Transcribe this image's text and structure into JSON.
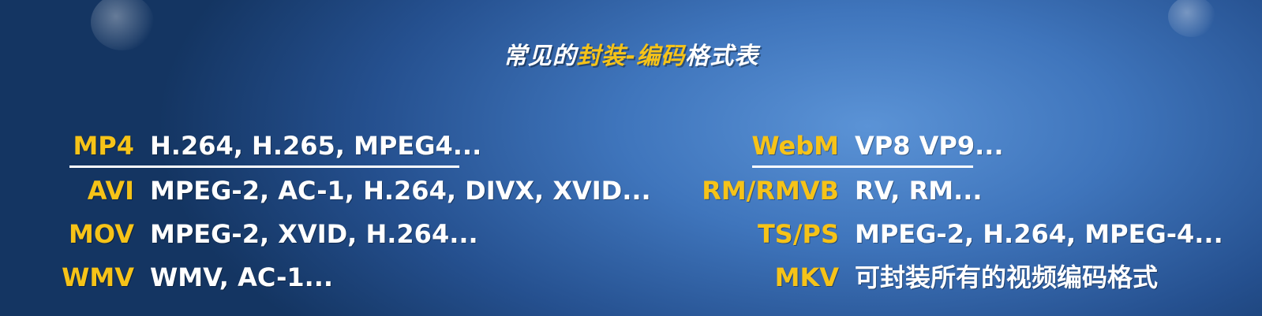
{
  "title": {
    "prefix": "常见的",
    "highlight1": "封装",
    "dash": "-",
    "highlight2": "编码",
    "suffix": "格式表"
  },
  "left_rows": [
    {
      "key": "MP4",
      "value": "H.264, H.265, MPEG4..."
    },
    {
      "key": "AVI",
      "value": "MPEG-2, AC-1, H.264, DIVX, XVID..."
    },
    {
      "key": "MOV",
      "value": "MPEG-2, XVID, H.264..."
    },
    {
      "key": "WMV",
      "value": "WMV, AC-1..."
    }
  ],
  "right_rows": [
    {
      "key": "WebM",
      "value": "VP8 VP9..."
    },
    {
      "key": "RM/RMVB",
      "value": "RV, RM..."
    },
    {
      "key": "TS/PS",
      "value": "MPEG-2, H.264, MPEG-4..."
    },
    {
      "key": "MKV",
      "value": "可封装所有的视频编码格式"
    }
  ],
  "colors": {
    "accent": "#f6c318",
    "text": "#ffffff",
    "background": "#2a5aa0"
  }
}
